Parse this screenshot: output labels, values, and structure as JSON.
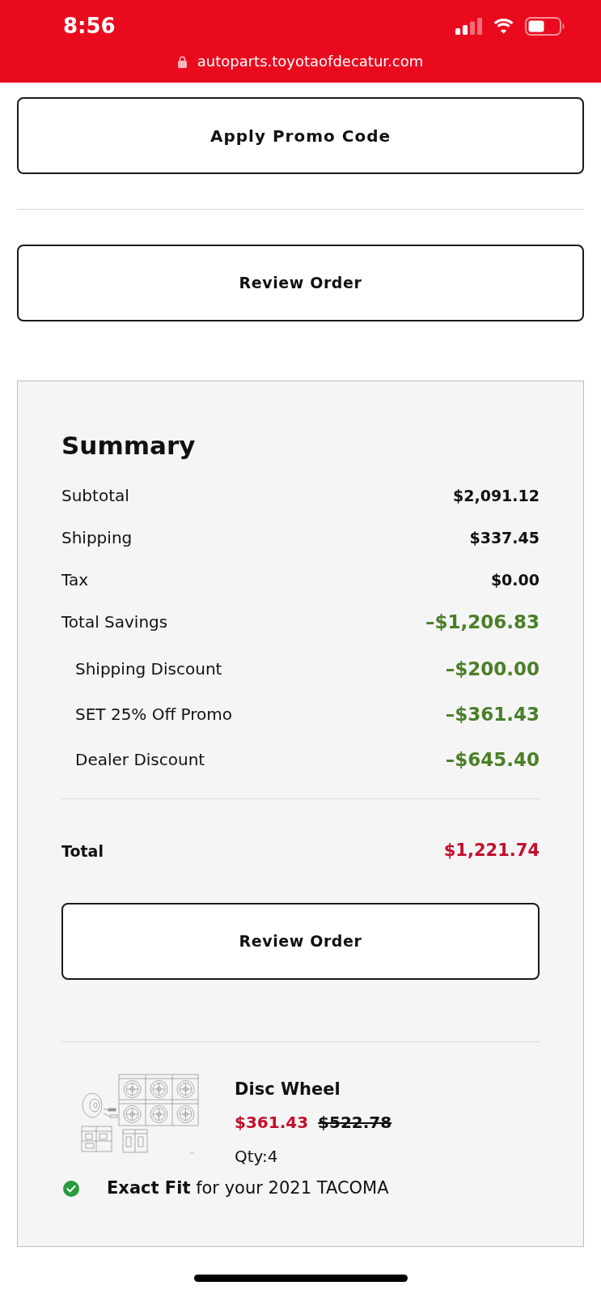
{
  "status_bar": {
    "time": "8:56",
    "url": "autoparts.toyotaofdecatur.com"
  },
  "promo_button": {
    "label": "Apply Promo Code"
  },
  "review_button": {
    "label": "Review Order"
  },
  "summary": {
    "title": "Summary",
    "rows": [
      {
        "label": "Subtotal",
        "value": "$2,091.12",
        "kind": "charge"
      },
      {
        "label": "Shipping",
        "value": "$337.45",
        "kind": "charge"
      },
      {
        "label": "Tax",
        "value": "$0.00",
        "kind": "charge"
      },
      {
        "label": "Total Savings",
        "value": "–$1,206.83",
        "kind": "savings",
        "children": [
          {
            "label": "Shipping Discount",
            "value": "–$200.00",
            "kind": "savings"
          },
          {
            "label": "SET 25% Off Promo",
            "value": "–$361.43",
            "kind": "savings"
          },
          {
            "label": "Dealer Discount",
            "value": "–$645.40",
            "kind": "savings"
          }
        ]
      }
    ],
    "total": {
      "label": "Total",
      "value": "$1,221.74"
    },
    "review_button": {
      "label": "Review Order"
    },
    "item": {
      "name": "Disc Wheel",
      "price": "$361.43",
      "original_price": "$522.78",
      "qty": "Qty:4",
      "fit": "**Exact Fit** for your 2021 TACOMA"
    }
  }
}
